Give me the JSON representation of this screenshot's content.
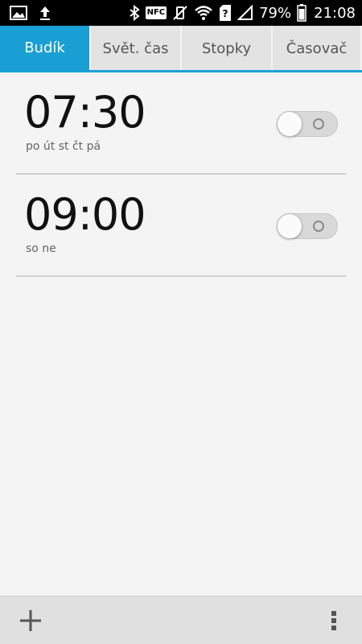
{
  "status_bar": {
    "battery_percent": "79%",
    "time": "21:08",
    "nfc_label": "NFC"
  },
  "tabs": [
    {
      "label": "Budík",
      "active": true
    },
    {
      "label": "Svět. čas",
      "active": false
    },
    {
      "label": "Stopky",
      "active": false
    },
    {
      "label": "Časovač",
      "active": false
    }
  ],
  "alarms": [
    {
      "time": "07:30",
      "days": "po út st čt pá",
      "enabled": false
    },
    {
      "time": "09:00",
      "days": "so ne",
      "enabled": false
    }
  ],
  "colors": {
    "accent": "#1a9fd4",
    "status_bar_bg": "#000000",
    "background": "#f4f4f4"
  },
  "icons": {
    "add": "plus-icon",
    "menu": "overflow-menu-icon"
  }
}
